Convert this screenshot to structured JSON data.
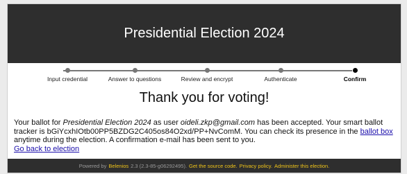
{
  "header": {
    "title": "Presidential Election 2024"
  },
  "steps": [
    {
      "label": "Input credential"
    },
    {
      "label": "Answer to questions"
    },
    {
      "label": "Review and encrypt"
    },
    {
      "label": "Authenticate"
    },
    {
      "label": "Confirm"
    }
  ],
  "main": {
    "thanks": "Thank you for voting!",
    "msg_p1": "Your ballot for ",
    "election_name": "Presidential Election 2024",
    "msg_p2": " as user ",
    "user_email": "oideli.zkp@gmail.com",
    "msg_p3": " has been accepted. Your smart ballot tracker is bGiYcxhIOtb00PP5BZDG2C405os84O2xd/PP+NvComM. You can check its presence in the ",
    "ballot_box_link": "ballot box",
    "msg_p4": " anytime during the election. A confirmation e-mail has been sent to you.",
    "back_link": "Go back to election"
  },
  "footer": {
    "powered_by": "Powered by",
    "belenios_link": "Belenios",
    "version": "2.3 (2.3-85-g06292495).",
    "source_link": "Get the source code.",
    "privacy_link": "Privacy policy.",
    "admin_link": "Administer this election."
  }
}
